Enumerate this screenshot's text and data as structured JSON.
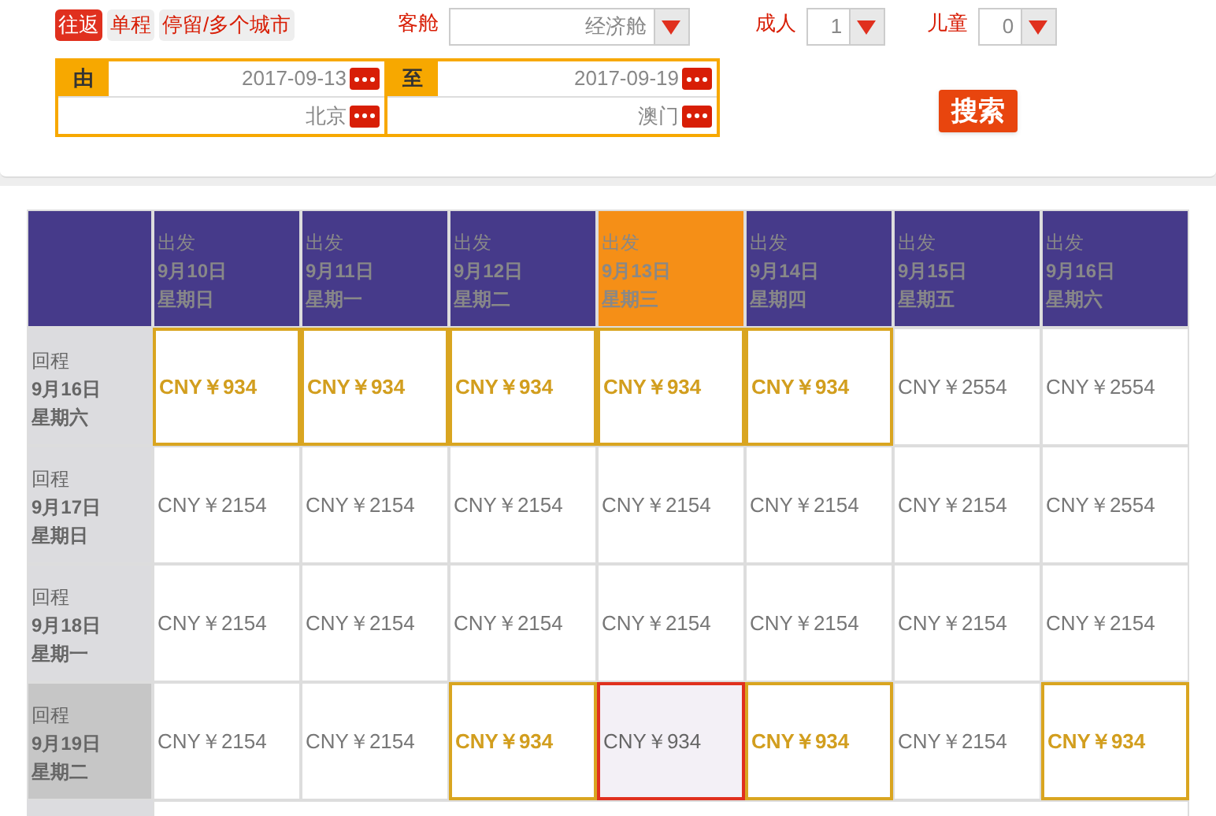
{
  "trip_tabs": [
    {
      "label": "往返",
      "selected": true
    },
    {
      "label": "单程",
      "selected": false
    },
    {
      "label": "停留/多个城市",
      "selected": false
    }
  ],
  "cabin": {
    "label": "客舱",
    "value": "经济舱"
  },
  "adults": {
    "label": "成人",
    "value": "1"
  },
  "children": {
    "label": "儿童",
    "value": "0"
  },
  "from": {
    "label": "由",
    "date": "2017-09-13",
    "city": "北京"
  },
  "to": {
    "label": "至",
    "date": "2017-09-19",
    "city": "澳门"
  },
  "search_button": "搜索",
  "columns": [
    {
      "label": "出发",
      "date": "9月10日",
      "weekday": "星期日",
      "selected": false
    },
    {
      "label": "出发",
      "date": "9月11日",
      "weekday": "星期一",
      "selected": false
    },
    {
      "label": "出发",
      "date": "9月12日",
      "weekday": "星期二",
      "selected": false
    },
    {
      "label": "出发",
      "date": "9月13日",
      "weekday": "星期三",
      "selected": true
    },
    {
      "label": "出发",
      "date": "9月14日",
      "weekday": "星期四",
      "selected": false
    },
    {
      "label": "出发",
      "date": "9月15日",
      "weekday": "星期五",
      "selected": false
    },
    {
      "label": "出发",
      "date": "9月16日",
      "weekday": "星期六",
      "selected": false
    }
  ],
  "rows": [
    {
      "label": "回程",
      "date": "9月16日",
      "weekday": "星期六",
      "selected": false,
      "cells": [
        {
          "price": "CNY￥934",
          "cheapest": true,
          "selected": false
        },
        {
          "price": "CNY￥934",
          "cheapest": true,
          "selected": false
        },
        {
          "price": "CNY￥934",
          "cheapest": true,
          "selected": false
        },
        {
          "price": "CNY￥934",
          "cheapest": true,
          "selected": false
        },
        {
          "price": "CNY￥934",
          "cheapest": true,
          "selected": false
        },
        {
          "price": "CNY￥2554",
          "cheapest": false,
          "selected": false
        },
        {
          "price": "CNY￥2554",
          "cheapest": false,
          "selected": false
        }
      ]
    },
    {
      "label": "回程",
      "date": "9月17日",
      "weekday": "星期日",
      "selected": false,
      "cells": [
        {
          "price": "CNY￥2154",
          "cheapest": false,
          "selected": false
        },
        {
          "price": "CNY￥2154",
          "cheapest": false,
          "selected": false
        },
        {
          "price": "CNY￥2154",
          "cheapest": false,
          "selected": false
        },
        {
          "price": "CNY￥2154",
          "cheapest": false,
          "selected": false
        },
        {
          "price": "CNY￥2154",
          "cheapest": false,
          "selected": false
        },
        {
          "price": "CNY￥2154",
          "cheapest": false,
          "selected": false
        },
        {
          "price": "CNY￥2554",
          "cheapest": false,
          "selected": false
        }
      ]
    },
    {
      "label": "回程",
      "date": "9月18日",
      "weekday": "星期一",
      "selected": false,
      "cells": [
        {
          "price": "CNY￥2154",
          "cheapest": false,
          "selected": false
        },
        {
          "price": "CNY￥2154",
          "cheapest": false,
          "selected": false
        },
        {
          "price": "CNY￥2154",
          "cheapest": false,
          "selected": false
        },
        {
          "price": "CNY￥2154",
          "cheapest": false,
          "selected": false
        },
        {
          "price": "CNY￥2154",
          "cheapest": false,
          "selected": false
        },
        {
          "price": "CNY￥2154",
          "cheapest": false,
          "selected": false
        },
        {
          "price": "CNY￥2154",
          "cheapest": false,
          "selected": false
        }
      ]
    },
    {
      "label": "回程",
      "date": "9月19日",
      "weekday": "星期二",
      "selected": true,
      "cells": [
        {
          "price": "CNY￥2154",
          "cheapest": false,
          "selected": false
        },
        {
          "price": "CNY￥2154",
          "cheapest": false,
          "selected": false
        },
        {
          "price": "CNY￥934",
          "cheapest": true,
          "selected": false
        },
        {
          "price": "CNY￥934",
          "cheapest": false,
          "selected": true
        },
        {
          "price": "CNY￥934",
          "cheapest": true,
          "selected": false
        },
        {
          "price": "CNY￥2154",
          "cheapest": false,
          "selected": false
        },
        {
          "price": "CNY￥934",
          "cheapest": true,
          "selected": false
        }
      ]
    }
  ]
}
